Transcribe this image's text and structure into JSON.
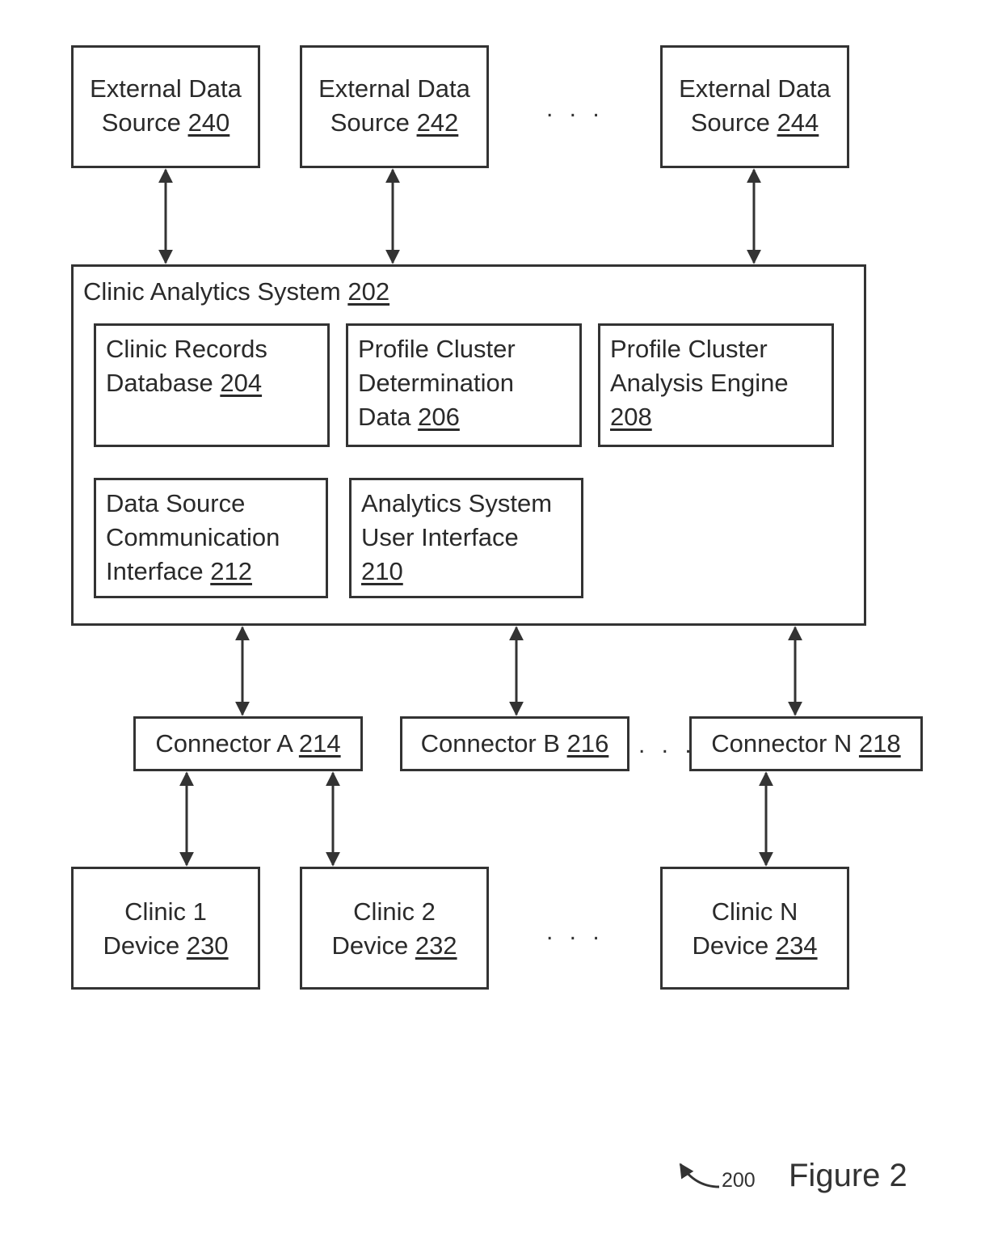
{
  "external_sources": [
    {
      "line1": "External Data",
      "name": "Source",
      "ref": "240"
    },
    {
      "line1": "External Data",
      "name": "Source",
      "ref": "242"
    },
    {
      "line1": "External Data",
      "name": "Source",
      "ref": "244"
    }
  ],
  "system": {
    "title": "Clinic Analytics System",
    "ref": "202",
    "components": [
      {
        "lines": [
          "Clinic Records",
          "Database"
        ],
        "ref": "204"
      },
      {
        "lines": [
          "Profile Cluster",
          "Determination",
          "Data"
        ],
        "ref": "206"
      },
      {
        "lines": [
          "Profile Cluster",
          "Analysis Engine",
          ""
        ],
        "ref": "208"
      },
      {
        "lines": [
          "Data Source",
          "Communication",
          "Interface"
        ],
        "ref": "212"
      },
      {
        "lines": [
          "Analytics System",
          "User Interface",
          ""
        ],
        "ref": "210"
      }
    ]
  },
  "connectors": [
    {
      "name": "Connector A",
      "ref": "214"
    },
    {
      "name": "Connector B",
      "ref": "216"
    },
    {
      "name": "Connector N",
      "ref": "218"
    }
  ],
  "devices": [
    {
      "line1": "Clinic 1",
      "name": "Device",
      "ref": "230"
    },
    {
      "line1": "Clinic 2",
      "name": "Device",
      "ref": "232"
    },
    {
      "line1": "Clinic N",
      "name": "Device",
      "ref": "234"
    }
  ],
  "ellipsis": ". . .",
  "figure": {
    "ref": "200",
    "label": "Figure 2"
  }
}
